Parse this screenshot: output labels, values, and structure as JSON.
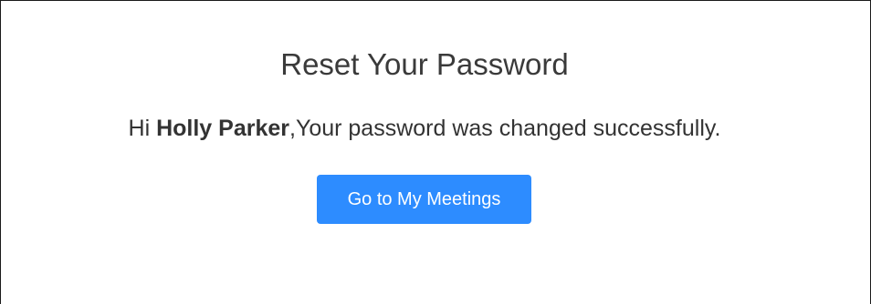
{
  "page": {
    "title": "Reset Your Password",
    "message": {
      "greeting": "Hi ",
      "user_name": "Holly Parker",
      "text": ",Your password was changed successfully."
    },
    "primary_button_label": "Go to My Meetings"
  },
  "colors": {
    "accent": "#2d8cff",
    "text": "#333333",
    "border": "#1a1a1a"
  }
}
